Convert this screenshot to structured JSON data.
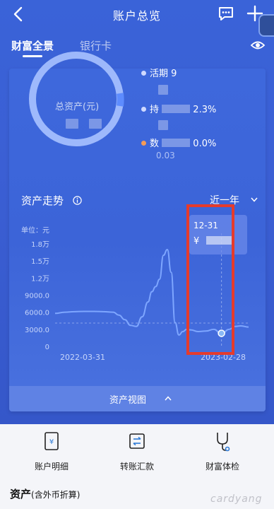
{
  "header": {
    "title": "账户总览",
    "back_icon": "chevron-left-icon",
    "message_icon": "message-icon",
    "add_icon": "plus-icon"
  },
  "tabs": {
    "items": [
      {
        "label": "财富全景",
        "active": true
      },
      {
        "label": "银行卡",
        "active": false
      }
    ],
    "eye_icon": "eye-icon"
  },
  "summary": {
    "donut_label": "总资产(元)",
    "legend": [
      {
        "label": "活期 9",
        "color": "#cfd9ff"
      },
      {
        "label": "持 (obscured) 2.3%",
        "text_visible": "持",
        "text_value": "2.3%",
        "color": "#cfd9ff"
      },
      {
        "label": "数 (obscured) 0.0%",
        "text_visible": "数",
        "text_value": "0.0%",
        "color": "#f59b57"
      }
    ],
    "legend_sub": "0.03",
    "colors": {
      "ring": "#a9c2ff",
      "ring_accent": "#5d8cff"
    }
  },
  "trend": {
    "title": "资产走势",
    "info_icon": "info-icon",
    "period": "近一年",
    "tooltip": {
      "date": "12-31",
      "currency": "¥"
    },
    "view_label": "资产视图",
    "view_icon": "chevron-up-icon"
  },
  "chart_data": {
    "type": "line",
    "unit_label": "单位：元",
    "y_ticks": [
      "0",
      "3000.0",
      "6000.0",
      "9000.0",
      "1.2万",
      "1.5万",
      "1.8万"
    ],
    "x_labels": [
      "2022-03-31",
      "2023-02-28"
    ],
    "ylim": [
      0,
      18000
    ],
    "series": [
      {
        "x": [
          0,
          0.05,
          0.1,
          0.15,
          0.2,
          0.25,
          0.3,
          0.33,
          0.36,
          0.39,
          0.42,
          0.45,
          0.48,
          0.5,
          0.52,
          0.54,
          0.56,
          0.58,
          0.6,
          0.62,
          0.64,
          0.66,
          0.68,
          0.7,
          0.74,
          0.78,
          0.82,
          0.86,
          0.9,
          0.93,
          0.96,
          1.0
        ],
        "values": [
          5800,
          6000,
          6100,
          6150,
          6150,
          6100,
          6000,
          5500,
          4700,
          3700,
          3500,
          5200,
          7800,
          9600,
          10500,
          11800,
          16000,
          17000,
          13000,
          4200,
          2000,
          2600,
          3000,
          2900,
          2600,
          2700,
          3000,
          2200,
          3000,
          3500,
          3600,
          3400
        ]
      }
    ],
    "highlight": {
      "x": 0.86,
      "value": 2300
    },
    "reference_line": 4100,
    "grid": false
  },
  "actions": [
    {
      "label": "账户明细",
      "icon": "account-detail-icon"
    },
    {
      "label": "转账汇款",
      "icon": "transfer-icon"
    },
    {
      "label": "财富体检",
      "icon": "stethoscope-icon"
    }
  ],
  "assets": {
    "title": "资产",
    "note": "(含外币折算)"
  },
  "watermark": "cardyang",
  "colors": {
    "primary": "#3a63d8",
    "annotation": "#e53b2c"
  }
}
